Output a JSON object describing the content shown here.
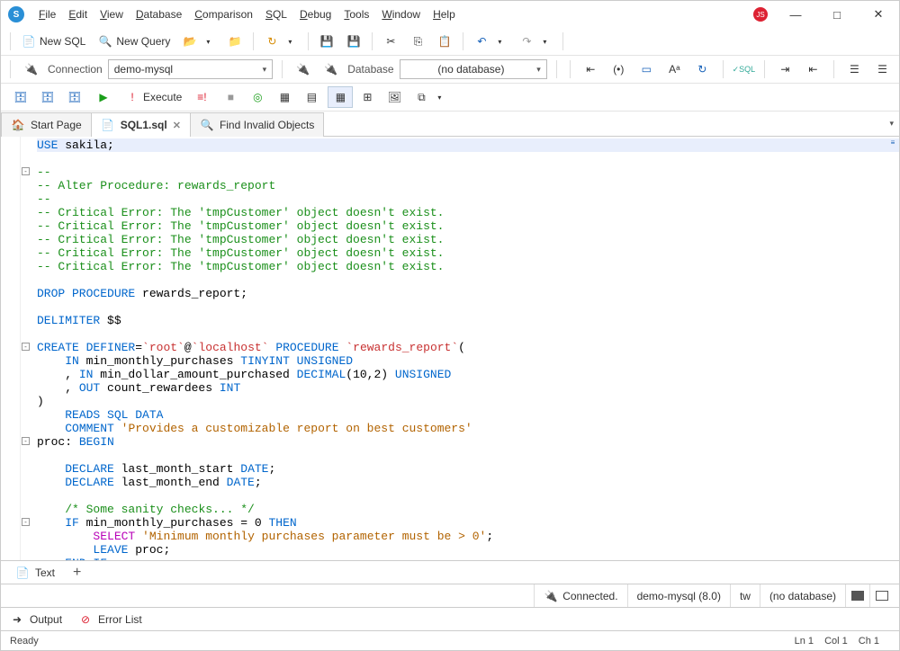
{
  "menu": [
    "File",
    "Edit",
    "View",
    "Database",
    "Comparison",
    "SQL",
    "Debug",
    "Tools",
    "Window",
    "Help"
  ],
  "toolbar1": {
    "newSql": "New SQL",
    "newQuery": "New Query"
  },
  "connRow": {
    "connLabel": "Connection",
    "connValue": "demo-mysql",
    "dbLabel": "Database",
    "dbValue": "(no database)"
  },
  "execute": "Execute",
  "tabs": [
    {
      "label": "Start Page",
      "active": false,
      "closable": false,
      "icon": "home"
    },
    {
      "label": "SQL1.sql",
      "active": true,
      "closable": true,
      "icon": "sql"
    },
    {
      "label": "Find Invalid Objects",
      "active": false,
      "closable": false,
      "icon": "search"
    }
  ],
  "code_lines": [
    {
      "t": "hl",
      "segs": [
        [
          "kw",
          "USE"
        ],
        [
          "id",
          " sakila"
        ],
        [
          "id",
          ";"
        ]
      ]
    },
    {
      "t": "",
      "segs": []
    },
    {
      "t": "",
      "segs": [
        [
          "cm",
          "--"
        ]
      ]
    },
    {
      "t": "",
      "segs": [
        [
          "cm",
          "-- Alter Procedure: rewards_report"
        ]
      ]
    },
    {
      "t": "",
      "segs": [
        [
          "cm",
          "--"
        ]
      ]
    },
    {
      "t": "",
      "segs": [
        [
          "cm",
          "-- Critical Error: The 'tmpCustomer' object doesn't exist."
        ]
      ]
    },
    {
      "t": "",
      "segs": [
        [
          "cm",
          "-- Critical Error: The 'tmpCustomer' object doesn't exist."
        ]
      ]
    },
    {
      "t": "",
      "segs": [
        [
          "cm",
          "-- Critical Error: The 'tmpCustomer' object doesn't exist."
        ]
      ]
    },
    {
      "t": "",
      "segs": [
        [
          "cm",
          "-- Critical Error: The 'tmpCustomer' object doesn't exist."
        ]
      ]
    },
    {
      "t": "",
      "segs": [
        [
          "cm",
          "-- Critical Error: The 'tmpCustomer' object doesn't exist."
        ]
      ]
    },
    {
      "t": "",
      "segs": []
    },
    {
      "t": "",
      "segs": [
        [
          "kw",
          "DROP PROCEDURE"
        ],
        [
          "id",
          " rewards_report;"
        ]
      ]
    },
    {
      "t": "",
      "segs": []
    },
    {
      "t": "",
      "segs": [
        [
          "kw",
          "DELIMITER"
        ],
        [
          "id",
          " $$"
        ]
      ]
    },
    {
      "t": "",
      "segs": []
    },
    {
      "t": "",
      "segs": [
        [
          "kw",
          "CREATE"
        ],
        [
          "id",
          " "
        ],
        [
          "kw",
          "DEFINER"
        ],
        [
          "id",
          "="
        ],
        [
          "red",
          "`root`"
        ],
        [
          "id",
          "@"
        ],
        [
          "red",
          "`localhost`"
        ],
        [
          "id",
          " "
        ],
        [
          "kw",
          "PROCEDURE"
        ],
        [
          "id",
          " "
        ],
        [
          "red",
          "`rewards_report`"
        ],
        [
          "id",
          "("
        ]
      ]
    },
    {
      "t": "",
      "segs": [
        [
          "id",
          "    "
        ],
        [
          "kw",
          "IN"
        ],
        [
          "id",
          " min_monthly_purchases "
        ],
        [
          "ty",
          "TINYINT UNSIGNED"
        ]
      ]
    },
    {
      "t": "",
      "segs": [
        [
          "id",
          "    , "
        ],
        [
          "kw",
          "IN"
        ],
        [
          "id",
          " min_dollar_amount_purchased "
        ],
        [
          "ty",
          "DECIMAL"
        ],
        [
          "id",
          "(10,2) "
        ],
        [
          "ty",
          "UNSIGNED"
        ]
      ]
    },
    {
      "t": "",
      "segs": [
        [
          "id",
          "    , "
        ],
        [
          "kw",
          "OUT"
        ],
        [
          "id",
          " count_rewardees "
        ],
        [
          "ty",
          "INT"
        ]
      ]
    },
    {
      "t": "",
      "segs": [
        [
          "id",
          ")"
        ]
      ]
    },
    {
      "t": "",
      "segs": [
        [
          "id",
          "    "
        ],
        [
          "kw",
          "READS SQL DATA"
        ]
      ]
    },
    {
      "t": "",
      "segs": [
        [
          "id",
          "    "
        ],
        [
          "kw",
          "COMMENT"
        ],
        [
          "id",
          " "
        ],
        [
          "str",
          "'Provides a customizable report on best customers'"
        ]
      ]
    },
    {
      "t": "",
      "segs": [
        [
          "id",
          "proc: "
        ],
        [
          "kw",
          "BEGIN"
        ]
      ]
    },
    {
      "t": "",
      "segs": []
    },
    {
      "t": "",
      "segs": [
        [
          "id",
          "    "
        ],
        [
          "kw",
          "DECLARE"
        ],
        [
          "id",
          " last_month_start "
        ],
        [
          "ty",
          "DATE"
        ],
        [
          "id",
          ";"
        ]
      ]
    },
    {
      "t": "",
      "segs": [
        [
          "id",
          "    "
        ],
        [
          "kw",
          "DECLARE"
        ],
        [
          "id",
          " last_month_end "
        ],
        [
          "ty",
          "DATE"
        ],
        [
          "id",
          ";"
        ]
      ]
    },
    {
      "t": "",
      "segs": []
    },
    {
      "t": "",
      "segs": [
        [
          "id",
          "    "
        ],
        [
          "cm",
          "/* Some sanity checks... */"
        ]
      ]
    },
    {
      "t": "",
      "segs": [
        [
          "id",
          "    "
        ],
        [
          "kw",
          "IF"
        ],
        [
          "id",
          " min_monthly_purchases = 0 "
        ],
        [
          "kw",
          "THEN"
        ]
      ]
    },
    {
      "t": "",
      "segs": [
        [
          "id",
          "        "
        ],
        [
          "fn",
          "SELECT"
        ],
        [
          "id",
          " "
        ],
        [
          "str",
          "'Minimum monthly purchases parameter must be > 0'"
        ],
        [
          "id",
          ";"
        ]
      ]
    },
    {
      "t": "",
      "segs": [
        [
          "id",
          "        "
        ],
        [
          "kw",
          "LEAVE"
        ],
        [
          "id",
          " proc;"
        ]
      ]
    },
    {
      "t": "",
      "segs": [
        [
          "id",
          "    "
        ],
        [
          "kw",
          "END IF"
        ],
        [
          "id",
          ";"
        ]
      ]
    }
  ],
  "foldMarks": [
    2,
    15,
    22,
    28
  ],
  "bottomTab": "Text",
  "status": {
    "connected": "Connected.",
    "server": "demo-mysql (8.0)",
    "user": "tw",
    "db": "(no database)"
  },
  "output": {
    "output": "Output",
    "errors": "Error List"
  },
  "ready": "Ready",
  "pos": {
    "ln": "Ln 1",
    "col": "Col 1",
    "ch": "Ch 1"
  }
}
